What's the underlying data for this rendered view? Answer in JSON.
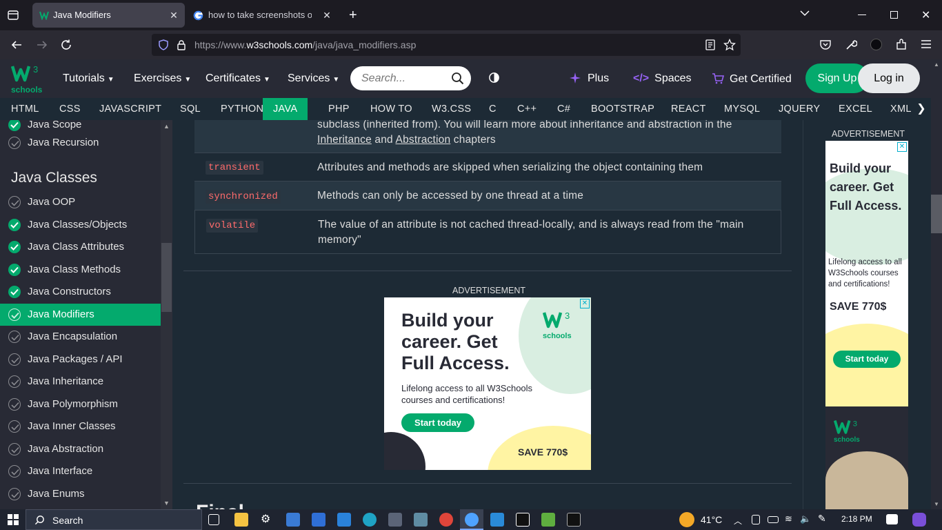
{
  "browser": {
    "tabs": [
      {
        "title": "Java Modifiers",
        "active": true
      },
      {
        "title": "how to take screenshots on lapt",
        "active": false
      }
    ],
    "url_prefix": "https://www.",
    "url_domain": "w3schools.com",
    "url_path": "/java/java_modifiers.asp"
  },
  "w3nav": {
    "logo_text": "schools",
    "logo_sup": "3",
    "menus": [
      "Tutorials",
      "Exercises",
      "Certificates",
      "Services"
    ],
    "search_placeholder": "Search...",
    "plus": "Plus",
    "spaces": "Spaces",
    "get_certified": "Get Certified",
    "sign_up": "Sign Up",
    "log_in": "Log in"
  },
  "subnav": [
    "HTML",
    "CSS",
    "JAVASCRIPT",
    "SQL",
    "PYTHON",
    "JAVA",
    "PHP",
    "HOW TO",
    "W3.CSS",
    "C",
    "C++",
    "C#",
    "BOOTSTRAP",
    "REACT",
    "MYSQL",
    "JQUERY",
    "EXCEL",
    "XML"
  ],
  "subnav_active": "JAVA",
  "sidebar": {
    "top_items": [
      {
        "label": "Java Scope",
        "done": true
      },
      {
        "label": "Java Recursion",
        "done": false
      }
    ],
    "section_heading": "Java Classes",
    "items": [
      {
        "label": "Java OOP",
        "done": false
      },
      {
        "label": "Java Classes/Objects",
        "done": true
      },
      {
        "label": "Java Class Attributes",
        "done": true
      },
      {
        "label": "Java Class Methods",
        "done": true
      },
      {
        "label": "Java Constructors",
        "done": true
      },
      {
        "label": "Java Modifiers",
        "done": false,
        "active": true
      },
      {
        "label": "Java Encapsulation",
        "done": false
      },
      {
        "label": "Java Packages / API",
        "done": false
      },
      {
        "label": "Java Inheritance",
        "done": false
      },
      {
        "label": "Java Polymorphism",
        "done": false
      },
      {
        "label": "Java Inner Classes",
        "done": false
      },
      {
        "label": "Java Abstraction",
        "done": false
      },
      {
        "label": "Java Interface",
        "done": false
      },
      {
        "label": "Java Enums",
        "done": false
      }
    ]
  },
  "modifiers_table": {
    "first_row_text": "subclass (inherited from). You will learn more about inheritance and abstraction in the",
    "first_row_link1": "Inheritance",
    "first_row_and": "and",
    "first_row_link2": "Abstraction",
    "first_row_end": "chapters",
    "rows": [
      {
        "modifier": "transient",
        "description": "Attributes and methods are skipped when serializing the object containing them"
      },
      {
        "modifier": "synchronized",
        "description": "Methods can only be accessed by one thread at a time"
      },
      {
        "modifier": "volatile",
        "description": "The value of an attribute is not cached thread-locally, and is always read from the \"main memory\""
      }
    ]
  },
  "ad_center": {
    "label": "ADVERTISEMENT",
    "headline": "Build your career. Get Full Access.",
    "body": "Lifelong access to all W3Schools courses and certifications!",
    "cta": "Start today",
    "save": "SAVE 770$",
    "logo": "schools",
    "logo_sup": "3"
  },
  "ad_right": {
    "label": "ADVERTISEMENT",
    "headline": "Build your career. Get Full Access.",
    "body": "Lifelong access to all W3Schools courses and certifications!",
    "save": "SAVE 770$",
    "cta": "Start today",
    "logo": "schools",
    "logo_sup": "3"
  },
  "next_heading_partial": "Final",
  "taskbar": {
    "search": "Search",
    "temperature": "41°C",
    "time": "2:18 PM"
  },
  "colors": {
    "accent_green": "#04aa6d",
    "nav_bg": "#282a35",
    "content_bg": "#1d2a35"
  }
}
